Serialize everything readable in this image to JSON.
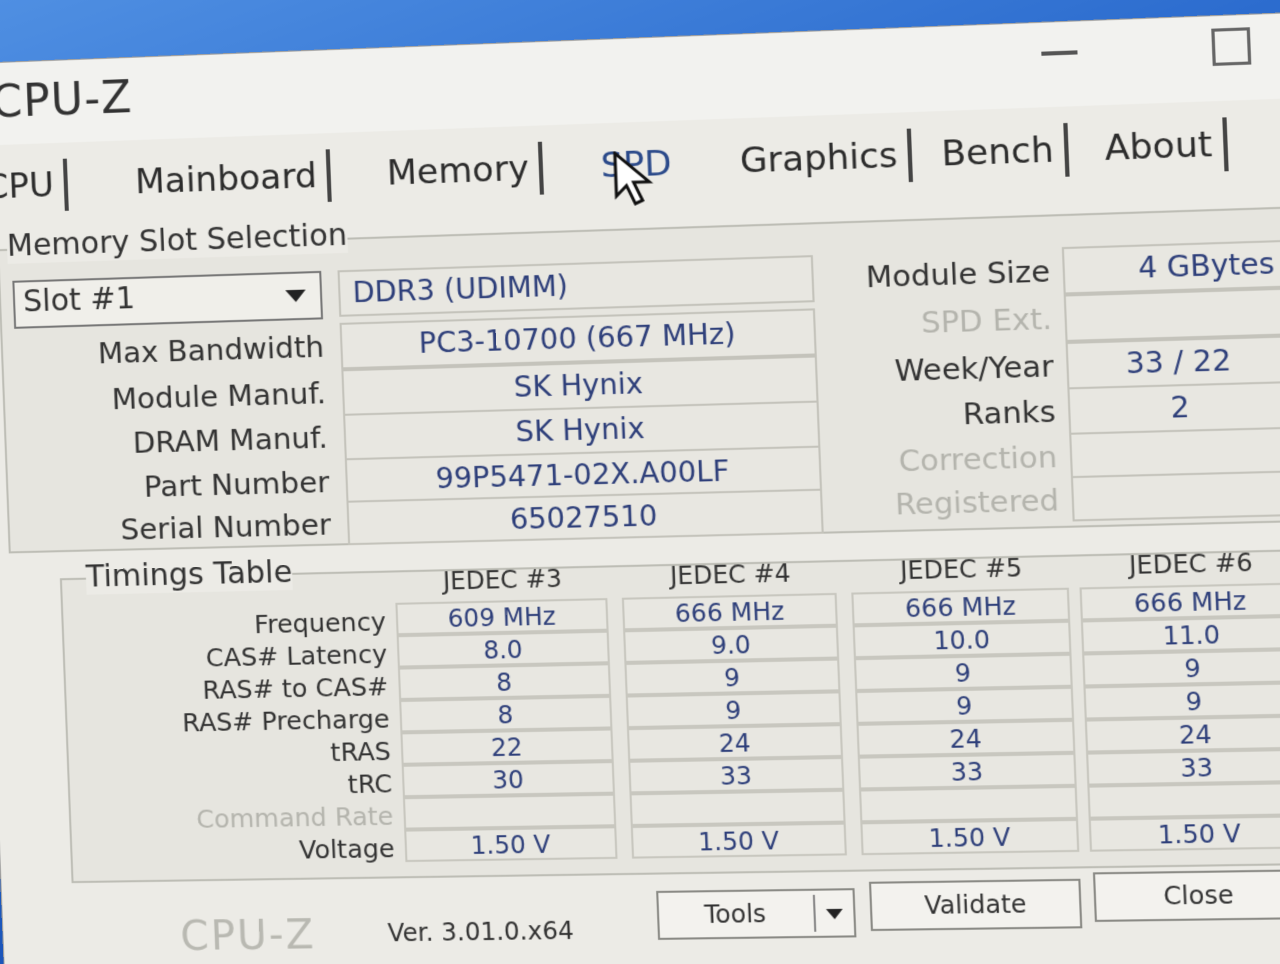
{
  "window": {
    "title": "CPU-Z"
  },
  "tabs": [
    {
      "label": "CPU"
    },
    {
      "label": "Mainboard"
    },
    {
      "label": "Memory"
    },
    {
      "label": "SPD"
    },
    {
      "label": "Graphics"
    },
    {
      "label": "Bench"
    },
    {
      "label": "About"
    }
  ],
  "slot_section": {
    "title": "Memory Slot Selection",
    "slot_value": "Slot #1",
    "memory_type": "DDR3 (UDIMM)",
    "labels": {
      "max_bandwidth": "Max Bandwidth",
      "module_manuf": "Module Manuf.",
      "dram_manuf": "DRAM Manuf.",
      "part_number": "Part Number",
      "serial_number": "Serial Number",
      "module_size": "Module Size",
      "spd_ext": "SPD Ext.",
      "week_year": "Week/Year",
      "ranks": "Ranks",
      "correction": "Correction",
      "registered": "Registered"
    },
    "values": {
      "max_bandwidth": "PC3-10700 (667 MHz)",
      "module_manuf": "SK Hynix",
      "dram_manuf": "SK Hynix",
      "part_number": "99P5471-02X.A00LF",
      "serial_number": "65027510",
      "module_size": "4 GBytes",
      "spd_ext": "",
      "week_year": "33 / 22",
      "ranks": "2",
      "correction": "",
      "registered": ""
    }
  },
  "timings": {
    "title": "Timings Table",
    "columns": [
      "JEDEC #3",
      "JEDEC #4",
      "JEDEC #5",
      "JEDEC #6"
    ],
    "row_labels": {
      "frequency": "Frequency",
      "cas": "CAS# Latency",
      "ras_cas": "RAS# to CAS#",
      "ras_pre": "RAS# Precharge",
      "tras": "tRAS",
      "trc": "tRC",
      "command_rate": "Command Rate",
      "voltage": "Voltage"
    },
    "rows": {
      "frequency": [
        "609 MHz",
        "666 MHz",
        "666 MHz",
        "666 MHz"
      ],
      "cas": [
        "8.0",
        "9.0",
        "10.0",
        "11.0"
      ],
      "ras_cas": [
        "8",
        "9",
        "9",
        "9"
      ],
      "ras_pre": [
        "8",
        "9",
        "9",
        "9"
      ],
      "tras": [
        "22",
        "24",
        "24",
        "24"
      ],
      "trc": [
        "30",
        "33",
        "33",
        "33"
      ],
      "command_rate": [
        "",
        "",
        "",
        ""
      ],
      "voltage": [
        "1.50 V",
        "1.50 V",
        "1.50 V",
        "1.50 V"
      ]
    }
  },
  "footer": {
    "brand": "CPU-Z",
    "version": "Ver. 3.01.0.x64",
    "tools_label": "Tools",
    "validate_label": "Validate",
    "close_label": "Close"
  }
}
